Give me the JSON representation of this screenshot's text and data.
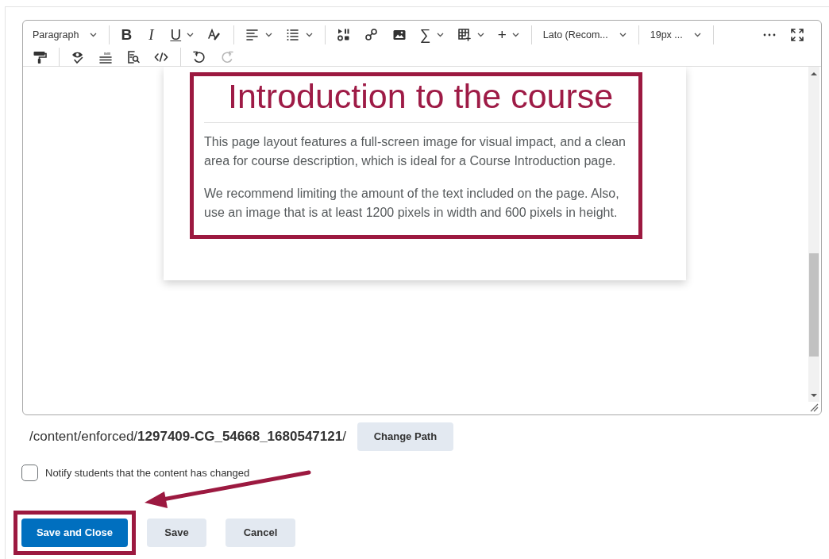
{
  "editor": {
    "toolbar": [
      [
        {
          "kind": "dropdown",
          "label": "Paragraph",
          "disabled": false
        },
        {
          "kind": "separator"
        },
        {
          "kind": "glyph",
          "label": "B",
          "disabled": false
        },
        {
          "kind": "glyph",
          "label": "I",
          "disabled": false
        },
        {
          "kind": "glyph",
          "label": "U",
          "caret": true,
          "disabled": false
        },
        {
          "kind": "icon",
          "disabled": false
        },
        {
          "kind": "separator"
        },
        {
          "kind": "icon",
          "caret": true,
          "disabled": false
        },
        {
          "kind": "icon",
          "caret": true,
          "disabled": false
        },
        {
          "kind": "separator"
        },
        {
          "kind": "icon",
          "disabled": false
        },
        {
          "kind": "icon",
          "disabled": false
        },
        {
          "kind": "icon",
          "disabled": false
        },
        {
          "kind": "glyph",
          "label": "∑",
          "caret": true,
          "disabled": false
        },
        {
          "kind": "icon",
          "caret": true,
          "disabled": false
        },
        {
          "kind": "glyph",
          "label": "+",
          "caret": true,
          "disabled": false
        },
        {
          "kind": "separator"
        },
        {
          "kind": "dropdown",
          "label": "Lato (Recom...",
          "disabled": false
        },
        {
          "kind": "separator"
        },
        {
          "kind": "dropdown",
          "label": "19px ...",
          "disabled": false
        },
        {
          "kind": "separator"
        },
        {
          "kind": "spacer"
        },
        {
          "kind": "icon",
          "disabled": false
        },
        {
          "kind": "icon",
          "disabled": false
        }
      ],
      [
        {
          "kind": "icon",
          "disabled": false
        },
        {
          "kind": "separator"
        },
        {
          "kind": "icon",
          "disabled": false
        },
        {
          "kind": "icon",
          "disabled": false
        },
        {
          "kind": "icon",
          "disabled": false
        },
        {
          "kind": "icon",
          "disabled": false
        },
        {
          "kind": "separator"
        },
        {
          "kind": "icon",
          "disabled": false
        },
        {
          "kind": "icon",
          "disabled": true
        }
      ]
    ],
    "content": {
      "heading": "Introduction to the course",
      "paragraphs": [
        "This page layout features a full-screen image for visual impact, and a clean area for course description, which is ideal for a Course Introduction page.",
        "We recommend limiting the amount of the text included on the page. Also, use an image that is at least 1200 pixels in width and 600 pixels in height."
      ],
      "highlighted": true
    }
  },
  "path": {
    "text": "/content/enforced/**1297409-CG_54668_1680547121**/",
    "button": "Change Path"
  },
  "notify": {
    "label": "Notify students that the content has changed",
    "checked": false
  },
  "buttons": [
    {
      "label": "Save and Close",
      "kind": "primary",
      "highlighted": true
    },
    {
      "label": "Save",
      "kind": "secondary",
      "highlighted": false
    },
    {
      "label": "Cancel",
      "kind": "secondary",
      "highlighted": false
    }
  ],
  "callout_arrow": true
}
